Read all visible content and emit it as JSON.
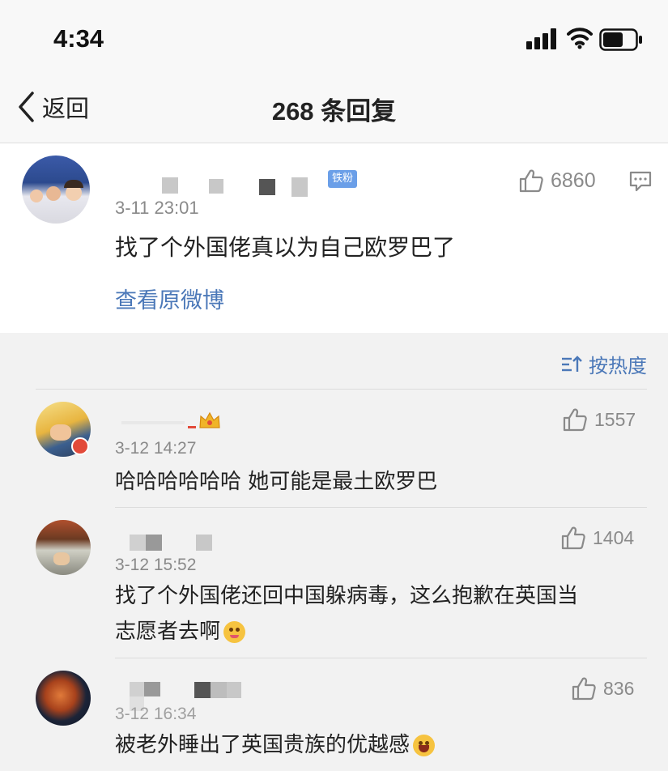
{
  "status_bar": {
    "time": "4:34"
  },
  "nav": {
    "back_label": "返回",
    "title": "268 条回复"
  },
  "main_post": {
    "badge": "铁粉",
    "time": "3-11 23:01",
    "text": "找了个外国佬真以为自己欧罗巴了",
    "likes": "6860",
    "view_original": "查看原微博"
  },
  "sort": {
    "label": "按热度"
  },
  "replies": [
    {
      "time": "3-12 14:27",
      "text": "哈哈哈哈哈哈 她可能是最土欧罗巴",
      "likes": "1557"
    },
    {
      "time": "3-12 15:52",
      "text_line1": "找了个外国佬还回中国躲病毒，这么抱歉在英国当",
      "text_line2": "志愿者去啊",
      "likes": "1404"
    },
    {
      "time": "3-12 16:34",
      "text": "被老外睡出了英国贵族的优越感",
      "likes": "836"
    }
  ],
  "icons": {
    "back": "chevron-left-icon",
    "like": "thumbs-up-icon",
    "comment": "comment-icon",
    "sort": "sort-icon",
    "emoji_yum": "yum-emoji-icon",
    "emoji_laugh": "laugh-emoji-icon"
  },
  "colors": {
    "link": "#4b78b8",
    "muted": "#8a8a8a",
    "badge": "#6b9fe8"
  }
}
